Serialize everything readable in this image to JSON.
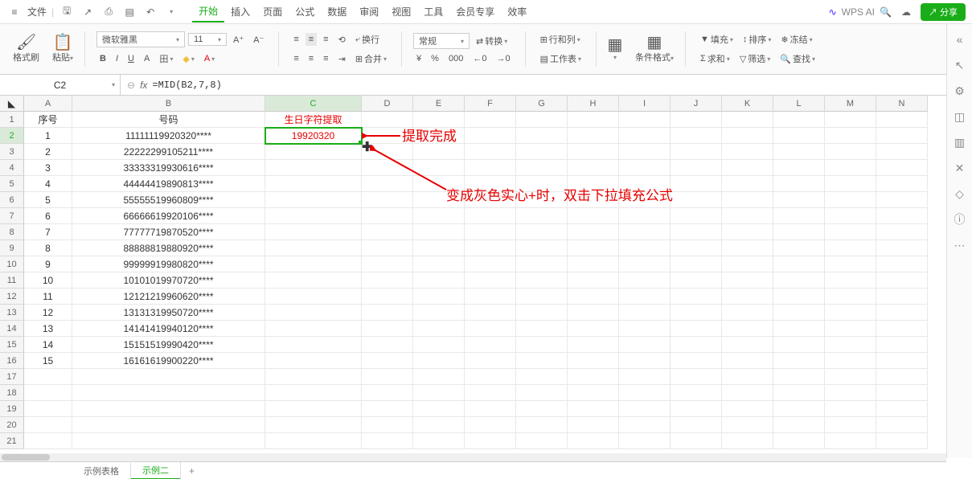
{
  "menu": {
    "file": "文件",
    "tabs": [
      "开始",
      "插入",
      "页面",
      "公式",
      "数据",
      "审阅",
      "视图",
      "工具",
      "会员专享",
      "效率"
    ],
    "active_tab": "开始",
    "wps_ai": "WPS AI",
    "share": "分享"
  },
  "ribbon": {
    "format_painter": "格式刷",
    "paste": "粘贴",
    "font": "微软雅黑",
    "font_size": "11",
    "general": "常规",
    "convert": "转换",
    "rowcol": "行和列",
    "worksheet": "工作表",
    "cond_fmt": "条件格式",
    "wrap": "换行",
    "merge": "合并",
    "fill": "填充",
    "sort": "排序",
    "freeze": "冻结",
    "sum": "求和",
    "filter": "筛选",
    "find": "查找"
  },
  "formula": {
    "cell_ref": "C2",
    "fx": "=MID(B2,7,8)"
  },
  "columns": [
    "A",
    "B",
    "C",
    "D",
    "E",
    "F",
    "G",
    "H",
    "I",
    "J",
    "K",
    "L",
    "M",
    "N"
  ],
  "headers": {
    "A": "序号",
    "B": "号码",
    "C": "生日字符提取"
  },
  "rows": [
    {
      "n": "1",
      "id": "11111119920320****",
      "ext": "19920320"
    },
    {
      "n": "2",
      "id": "22222299105211****"
    },
    {
      "n": "3",
      "id": "33333319930616****"
    },
    {
      "n": "4",
      "id": "44444419890813****"
    },
    {
      "n": "5",
      "id": "55555519960809****"
    },
    {
      "n": "6",
      "id": "66666619920106****"
    },
    {
      "n": "7",
      "id": "77777719870520****"
    },
    {
      "n": "8",
      "id": "88888819880920****"
    },
    {
      "n": "9",
      "id": "99999919980820****"
    },
    {
      "n": "10",
      "id": "10101019970720****"
    },
    {
      "n": "11",
      "id": "12121219960620****"
    },
    {
      "n": "12",
      "id": "13131319950720****"
    },
    {
      "n": "13",
      "id": "14141419940120****"
    },
    {
      "n": "14",
      "id": "15151519990420****"
    },
    {
      "n": "15",
      "id": "16161619900220****"
    }
  ],
  "annotations": {
    "a1": "提取完成",
    "a2": "变成灰色实心+时，双击下拉填充公式"
  },
  "sheets": {
    "s1": "示例表格",
    "s2": "示例二"
  },
  "icons": {
    "hamburger": "≡",
    "save": "🖫",
    "print": "⎙",
    "preview": "▤",
    "undo": "↶",
    "redo": "↷",
    "cloud": "☁",
    "search": "🔍",
    "bold": "B",
    "italic": "I",
    "underline": "U",
    "strike": "A",
    "border": "田",
    "fillc": "◆",
    "fontc": "A",
    "al": "≡",
    "ac": "≡",
    "ar": "≡",
    "currency": "¥",
    "percent": "%",
    "comma": ",",
    "dec_inc": ".0",
    "dec_dec": ".00",
    "table": "▦",
    "down": "▾",
    "plus": "+",
    "more": "⋯"
  }
}
